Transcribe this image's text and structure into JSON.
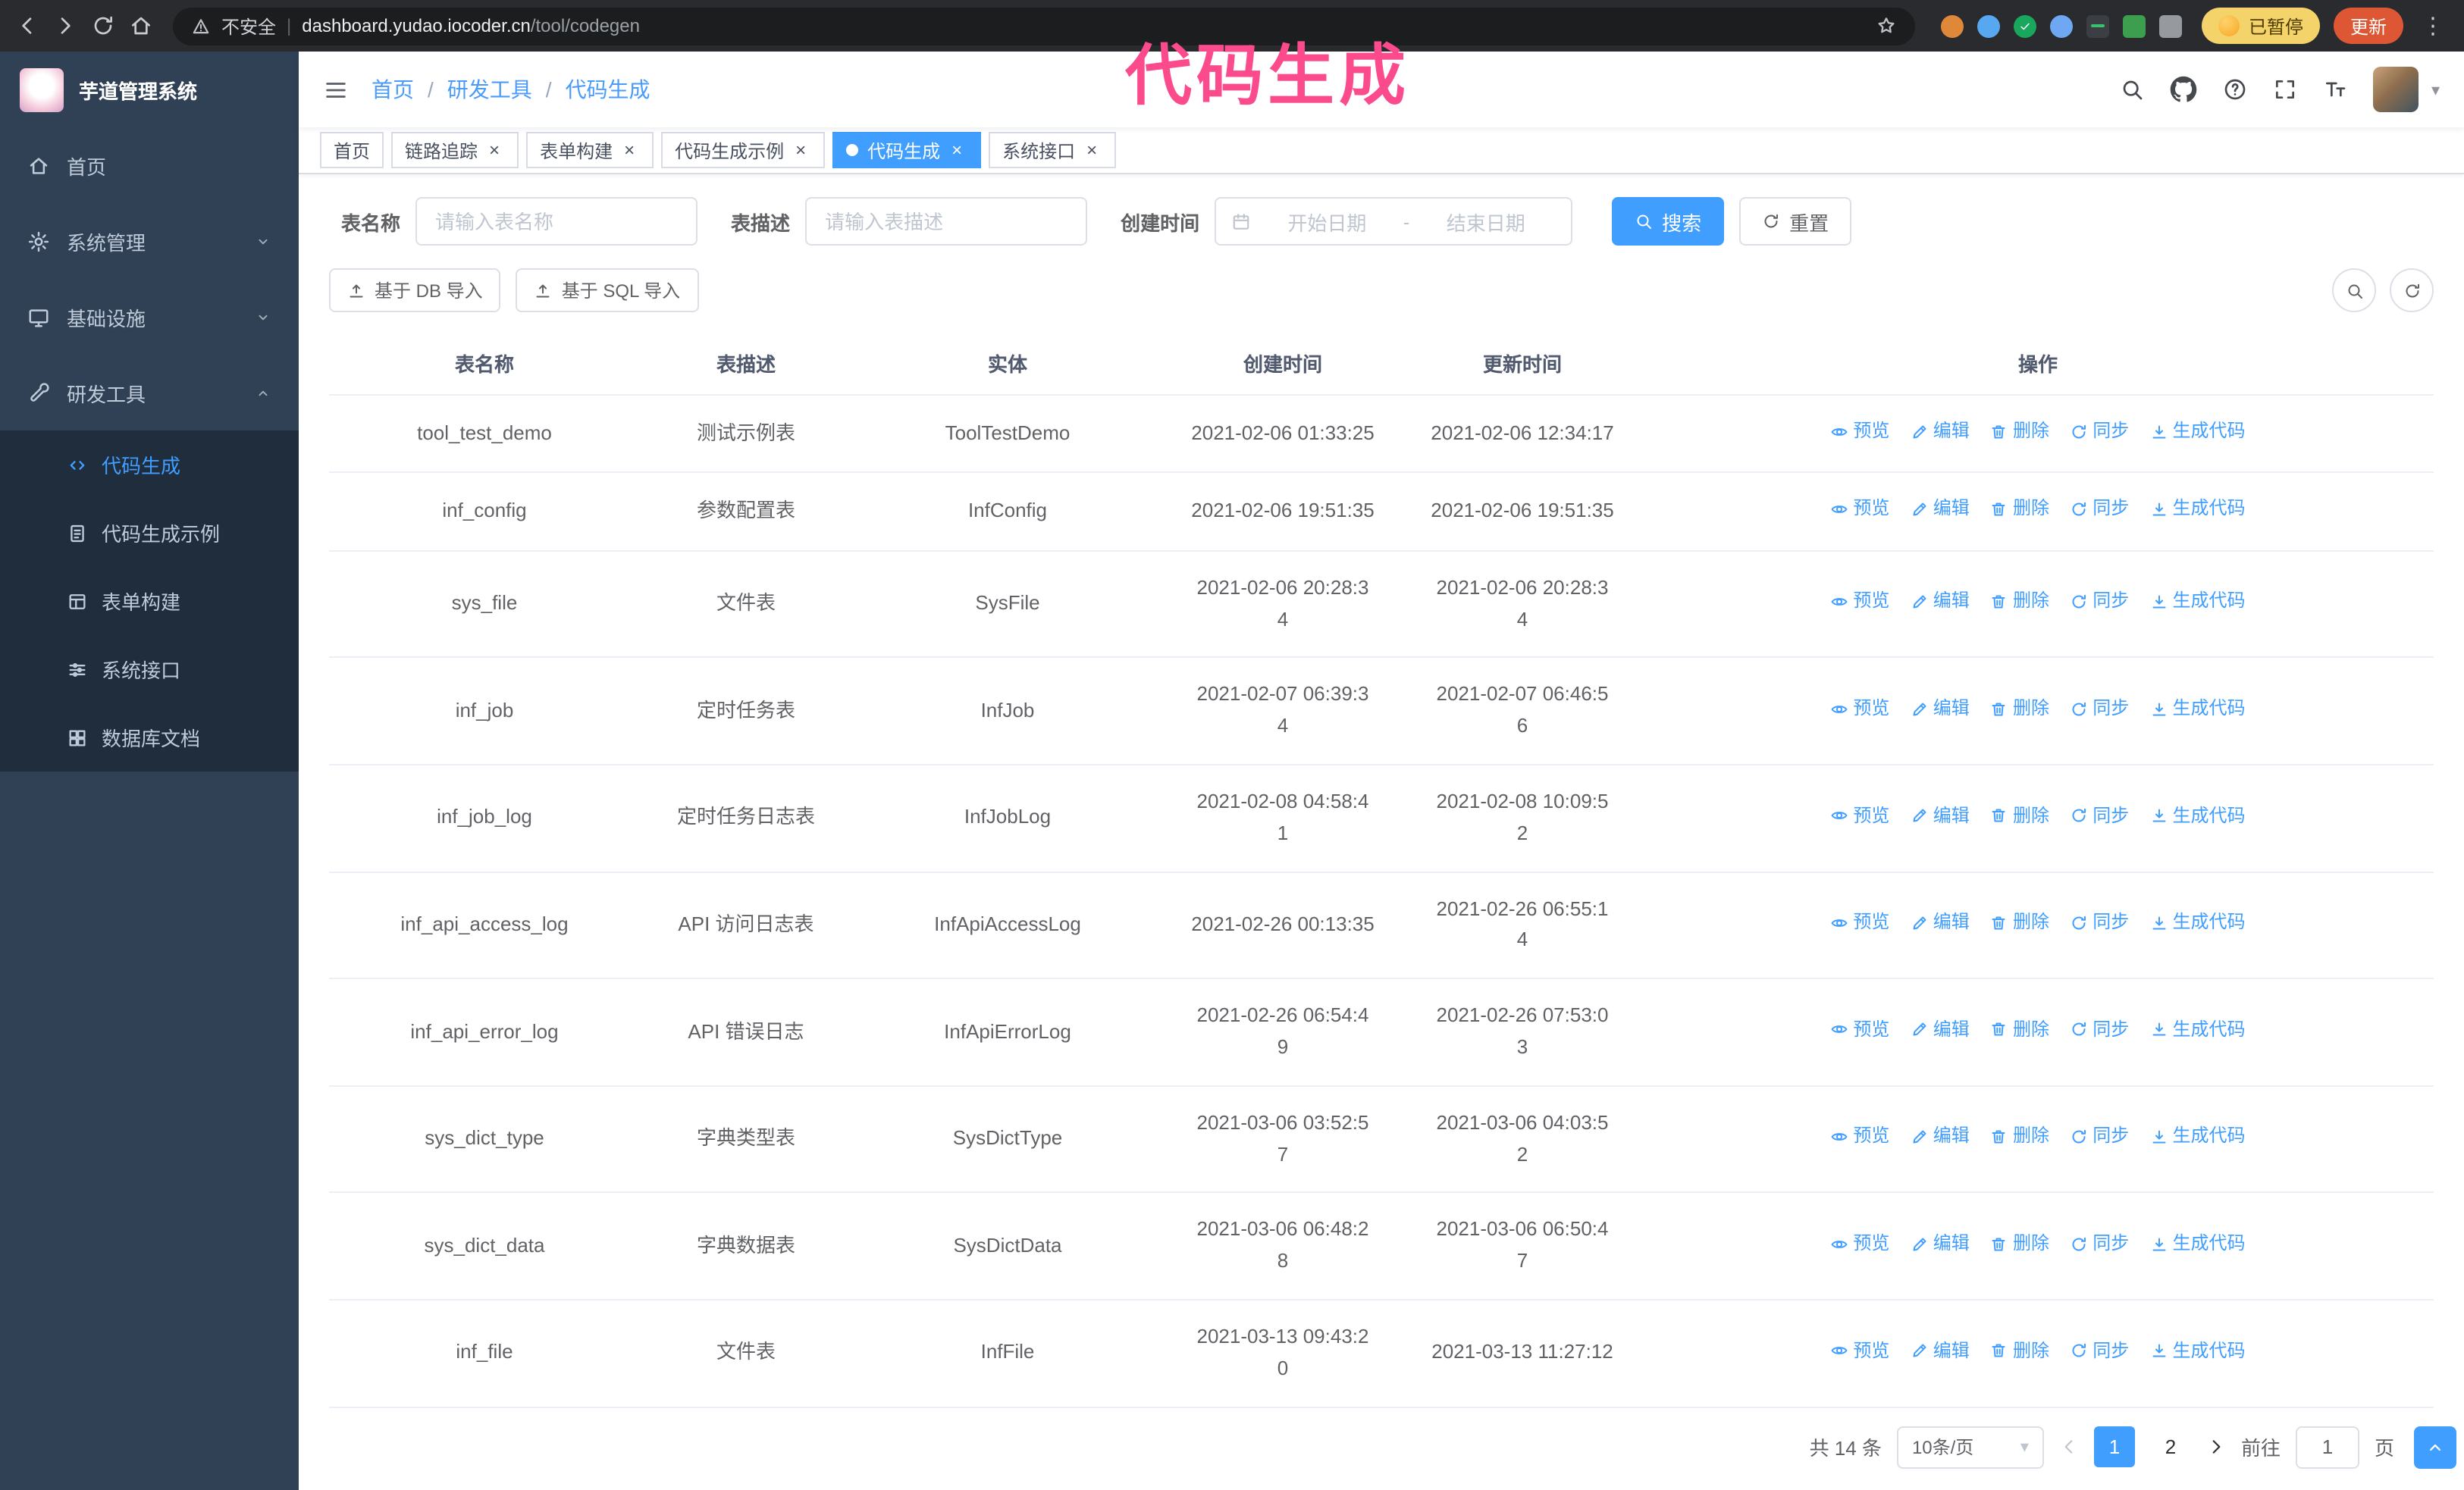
{
  "browser": {
    "security_label": "不安全",
    "url_host": "dashboard.yudao.iocoder.cn",
    "url_path": "/tool/codegen",
    "paused_badge": "已暂停",
    "update_button": "更新"
  },
  "annotation": {
    "text": "代码生成",
    "color": "#fb4b8c"
  },
  "icons": {
    "close": "×",
    "caret_down": "▾",
    "kebab": "⋮",
    "divider": "|"
  },
  "sidebar": {
    "logo_title": "芋道管理系统",
    "items": [
      {
        "label": "首页"
      },
      {
        "label": "系统管理"
      },
      {
        "label": "基础设施"
      },
      {
        "label": "研发工具"
      }
    ],
    "dev_tools_children": [
      {
        "label": "代码生成",
        "active": true
      },
      {
        "label": "代码生成示例"
      },
      {
        "label": "表单构建"
      },
      {
        "label": "系统接口"
      },
      {
        "label": "数据库文档"
      }
    ]
  },
  "topbar": {
    "breadcrumb": {
      "home": "首页",
      "parent": "研发工具",
      "current": "代码生成",
      "separator": "/"
    }
  },
  "tags": [
    {
      "label": "首页",
      "closable": false
    },
    {
      "label": "链路追踪",
      "closable": true
    },
    {
      "label": "表单构建",
      "closable": true
    },
    {
      "label": "代码生成示例",
      "closable": true
    },
    {
      "label": "代码生成",
      "closable": true,
      "active": true
    },
    {
      "label": "系统接口",
      "closable": true
    }
  ],
  "search_form": {
    "table_name_label": "表名称",
    "table_name_placeholder": "请输入表名称",
    "table_desc_label": "表描述",
    "table_desc_placeholder": "请输入表描述",
    "create_time_label": "创建时间",
    "date_start_placeholder": "开始日期",
    "date_separator": "-",
    "date_end_placeholder": "结束日期",
    "search_button": "搜索",
    "reset_button": "重置"
  },
  "toolbar": {
    "import_db_button": "基于 DB 导入",
    "import_sql_button": "基于 SQL 导入"
  },
  "table": {
    "columns": [
      "表名称",
      "表描述",
      "实体",
      "创建时间",
      "更新时间",
      "操作"
    ],
    "actions": {
      "preview": "预览",
      "edit": "编辑",
      "delete": "删除",
      "sync": "同步",
      "generate": "生成代码"
    },
    "rows": [
      {
        "name": "tool_test_demo",
        "desc": "测试示例表",
        "entity": "ToolTestDemo",
        "created": "2021-02-06 01:33:25",
        "updated": "2021-02-06 12:34:17"
      },
      {
        "name": "inf_config",
        "desc": "参数配置表",
        "entity": "InfConfig",
        "created": "2021-02-06 19:51:35",
        "updated": "2021-02-06 19:51:35"
      },
      {
        "name": "sys_file",
        "desc": "文件表",
        "entity": "SysFile",
        "created": "2021-02-06 20:28:3\n4",
        "updated": "2021-02-06 20:28:3\n4"
      },
      {
        "name": "inf_job",
        "desc": "定时任务表",
        "entity": "InfJob",
        "created": "2021-02-07 06:39:3\n4",
        "updated": "2021-02-07 06:46:5\n6"
      },
      {
        "name": "inf_job_log",
        "desc": "定时任务日志表",
        "entity": "InfJobLog",
        "created": "2021-02-08 04:58:4\n1",
        "updated": "2021-02-08 10:09:5\n2"
      },
      {
        "name": "inf_api_access_log",
        "desc": "API 访问日志表",
        "entity": "InfApiAccessLog",
        "created": "2021-02-26 00:13:35",
        "updated": "2021-02-26 06:55:1\n4"
      },
      {
        "name": "inf_api_error_log",
        "desc": "API 错误日志",
        "entity": "InfApiErrorLog",
        "created": "2021-02-26 06:54:4\n9",
        "updated": "2021-02-26 07:53:0\n3"
      },
      {
        "name": "sys_dict_type",
        "desc": "字典类型表",
        "entity": "SysDictType",
        "created": "2021-03-06 03:52:5\n7",
        "updated": "2021-03-06 04:03:5\n2"
      },
      {
        "name": "sys_dict_data",
        "desc": "字典数据表",
        "entity": "SysDictData",
        "created": "2021-03-06 06:48:2\n8",
        "updated": "2021-03-06 06:50:4\n7"
      },
      {
        "name": "inf_file",
        "desc": "文件表",
        "entity": "InfFile",
        "created": "2021-03-13 09:43:2\n0",
        "updated": "2021-03-13 11:27:12"
      }
    ]
  },
  "pagination": {
    "total_text": "共 14 条",
    "page_size": "10条/页",
    "pages": [
      "1",
      "2"
    ],
    "active_page": "1",
    "goto_label": "前往",
    "goto_value": "1",
    "goto_suffix": "页"
  }
}
